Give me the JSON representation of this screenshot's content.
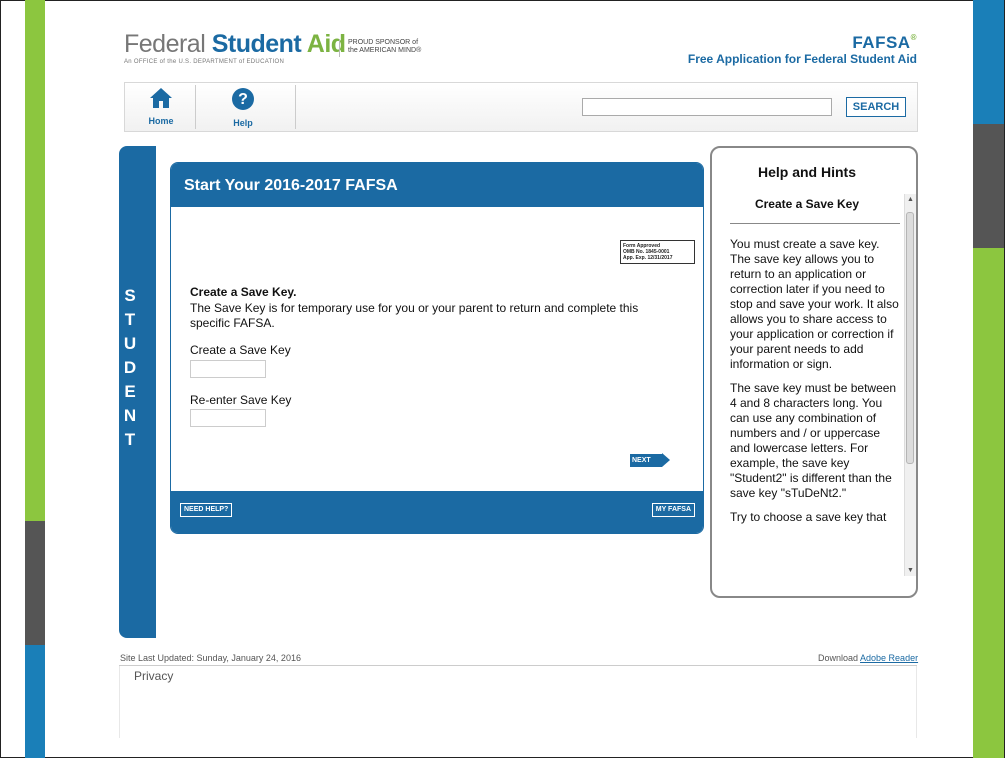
{
  "colors": {
    "green": "#8cc63f",
    "dark_gray": "#555555",
    "blue": "#1a7fb8",
    "fafsa_blue": "#1b6aa3"
  },
  "header": {
    "brand_federal": "Federal ",
    "brand_student": "Student ",
    "brand_aid": "Aid",
    "brand_sub": "An OFFICE of the U.S. DEPARTMENT of EDUCATION",
    "sponsor_line1": "PROUD SPONSOR of",
    "sponsor_line2": "the AMERICAN MIND®",
    "fafsa": "FAFSA",
    "fafsa_tm": "®",
    "fafsa_sub": "Free Application for Federal Student Aid"
  },
  "nav": {
    "home_label": "Home",
    "help_label": "Help",
    "search_value": "",
    "search_button": "SEARCH"
  },
  "student_tab": [
    "S",
    "T",
    "U",
    "D",
    "E",
    "N",
    "T"
  ],
  "main": {
    "title": "Start Your 2016-2017 FAFSA",
    "omb_line1": "Form Approved",
    "omb_line2": "OMB No. 1845-0001",
    "omb_line3": "App. Exp. 12/31/2017",
    "heading": "Create a Save Key.",
    "description": "The Save Key is for temporary use for you or your parent to return and complete this specific FAFSA.",
    "field1_label": "Create a Save Key",
    "field1_value": "",
    "field2_label": "Re-enter Save Key",
    "field2_value": "",
    "next_label": "NEXT",
    "need_help_label": "NEED HELP?",
    "my_fafsa_label": "MY FAFSA"
  },
  "help": {
    "title": "Help and Hints",
    "subtitle": "Create a Save Key",
    "para1": "You must create a save key. The save key allows you to return to an application or correction later if you need to stop and save your work. It also allows you to share access to your application or correction if your parent needs to add information or sign.",
    "para2": "The save key must be between 4 and 8 characters long. You can use any combination of numbers and / or uppercase and lowercase letters. For example, the save key \"Student2\" is different than the save key \"sTuDeNt2.\"",
    "para3": "Try to choose a save key that"
  },
  "footer": {
    "updated": "Site Last Updated: Sunday, January 24, 2016",
    "download_prefix": "Download ",
    "download_link": "Adobe Reader",
    "privacy": "Privacy"
  }
}
